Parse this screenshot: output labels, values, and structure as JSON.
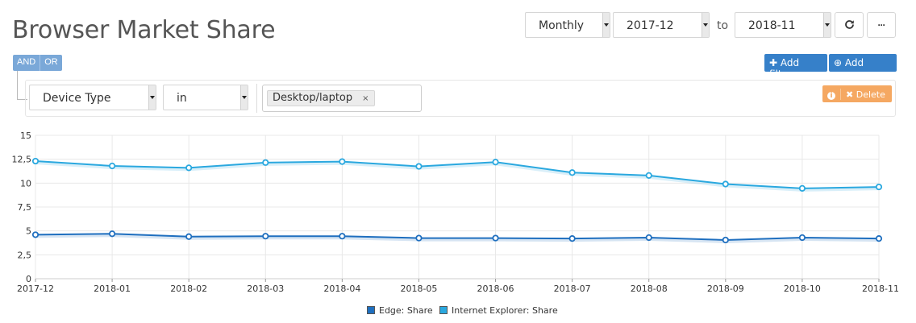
{
  "page": {
    "title": "Browser Market Share"
  },
  "toolbar": {
    "interval": "Monthly",
    "start": "2017-12",
    "to_label": "to",
    "end": "2018-11",
    "refresh_icon": "refresh-icon",
    "more_icon": "more-icon",
    "more_label": "···"
  },
  "filters": {
    "and_label": "AND",
    "or_label": "OR",
    "add_filter": "Add filter",
    "add_group": "Add group",
    "field": "Device Type",
    "operator": "in",
    "value_tag": "Desktop/laptop",
    "tag_remove": "×",
    "delete_label": "Delete",
    "colors": {
      "primary": "#3680c9",
      "warning": "#f5a862"
    }
  },
  "chart_data": {
    "type": "line",
    "title": "",
    "xlabel": "",
    "ylabel": "",
    "ylim": [
      0,
      15
    ],
    "yticks": [
      "0",
      "2,5",
      "5",
      "7,5",
      "10",
      "12,5",
      "15"
    ],
    "x": [
      "2017-12",
      "2018-01",
      "2018-02",
      "2018-03",
      "2018-04",
      "2018-05",
      "2018-06",
      "2018-07",
      "2018-08",
      "2018-09",
      "2018-10",
      "2018-11"
    ],
    "series": [
      {
        "name": "Edge: Share",
        "color": "#1f6fbf",
        "values": [
          4.6,
          4.7,
          4.4,
          4.45,
          4.45,
          4.25,
          4.25,
          4.2,
          4.3,
          4.05,
          4.3,
          4.2
        ]
      },
      {
        "name": "Internet Explorer: Share",
        "color": "#2aa8df",
        "values": [
          12.3,
          11.8,
          11.6,
          12.15,
          12.25,
          11.75,
          12.2,
          11.1,
          10.8,
          9.9,
          9.45,
          9.6
        ]
      }
    ],
    "grid": true,
    "legend": "bottom-center"
  }
}
